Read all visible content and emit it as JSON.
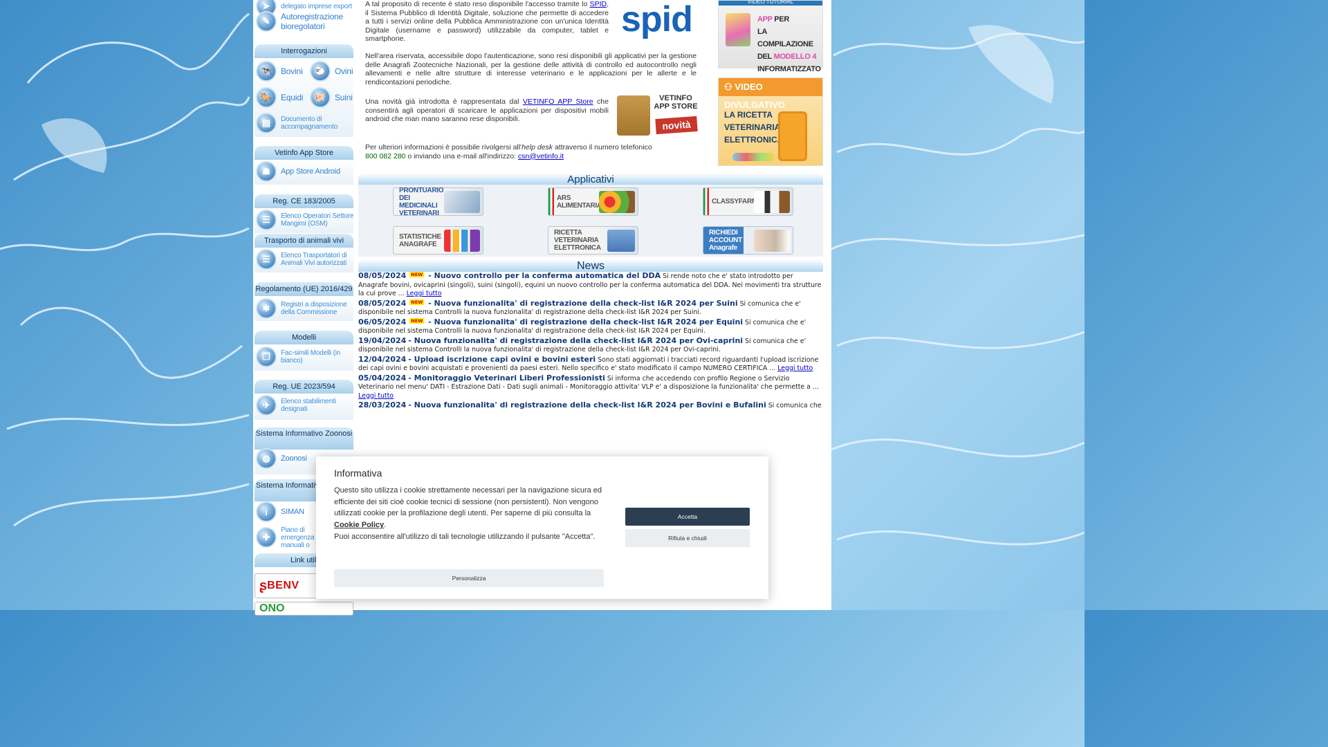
{
  "sidebar": {
    "top_item_partial": "delegato imprese export",
    "autoregistrazione": "Autoregistrazione bioregolatori",
    "sections": {
      "interrogazioni": "Interrogazioni",
      "app_store": "Vetinfo App Store",
      "reg_ce": "Reg. CE 183/2005",
      "trasporto": "Trasporto di animali vivi",
      "regolamento": "Regolamento (UE) 2016/429",
      "modelli": "Modelli",
      "reg_ue": "Reg. UE 2023/594",
      "zoonosi_title": "Sistema Informativo Zoonosi",
      "animali_title": "Sistema Informativo Animali",
      "link_utili": "Link utili"
    },
    "items": {
      "bovini": "Bovini",
      "ovini": "Ovini",
      "equidi": "Equidi",
      "suini": "Suini",
      "documento": "Documento di accompagnamento",
      "app_store_android": "App Store Android",
      "osm": "Elenco Operatori Settore Mangimi (OSM)",
      "trasportatori": "Elenco Trasportatori di Animali Vivi autorizzati",
      "registri": "Registri a disposizione della Commissione",
      "facsimili": "Fac-simili Modelli (in bianco)",
      "stabilimenti": "Elenco stabilimenti designati",
      "zoonosi": "Zoonosi",
      "siman": "SIMAN",
      "piano": "Piano di emergenza e manuali o",
      "benv": "BENV",
      "ono": "ONO"
    }
  },
  "intro": {
    "p1_a": "A tal proposito di recente è stato reso disponibile l'accesso tramite lo ",
    "p1_link": "SPID",
    "p1_b": ", il Sistema Pubblico di Identità Digitale, soluzione che permette di accedere a tutti i servizi online della Pubblica Amministrazione con un'unica Identità Digitale (username e password) utilizzabile da computer, tablet e smartphone.",
    "p2": "Nell'area riservata, accessibile dopo l'autenticazione, sono resi disponibili gli applicativi per la gestione delle Anagrafi Zootecniche Nazionali, per la gestione delle attività di controllo ed autocontrollo negli allevamenti e nelle altre strutture di interesse veterinario e le applicazioni per le allerte e le rendicontazioni periodiche.",
    "p3_a": "Una novità già introdotta è rappresentata dal ",
    "p3_link": "VETINFO APP Store",
    "p3_b": " che consentirà agli operatori di scaricare le applicazioni per dispositivi mobili android che man mano saranno rese disponibili.",
    "p4_a": "Per ulteriori informazioni è possibile rivolgersi all'",
    "p4_em": "help desk",
    "p4_b": " attraverso il numero telefonico",
    "phone": "800 082 280",
    "p4_c": " o inviando una e-mail all'indirizzo: ",
    "email": "csn@vetinfo.it",
    "spid_logo": "spid",
    "appstore_promo": "VETINFO APP STORE",
    "appstore_novita": "novità"
  },
  "promos": {
    "tutorial_header": "VIDEO TUTORIAL",
    "tutorial_l1a": "APP",
    "tutorial_l1b": " PER",
    "tutorial_l2": "LA COMPILAZIONE",
    "tutorial_l3a": "DEL ",
    "tutorial_l3b": "MODELLO 4",
    "tutorial_l4": "INFORMATIZZATO",
    "divulgativo_header": "VIDEO DIVULGATIVO",
    "divulgativo_l1": "LA RICETTA",
    "divulgativo_l2": "VETERINARIA",
    "divulgativo_l3": "ELETTRONICA"
  },
  "applicativi": {
    "title": "Applicativi",
    "apps": [
      "PRONTUARIO DEI MEDICINALI VETERINARI",
      "ARS ALIMENTARIA",
      "CLASSYFARM",
      "STATISTICHE ANAGRAFE",
      "RICETTA VETERINARIA ELETTRONICA",
      "RICHIEDI ACCOUNT Anagrafe"
    ]
  },
  "news": {
    "title": "News",
    "new_badge": "NEW",
    "read_more": "Leggi tutto",
    "items": [
      {
        "date": "08/05/2024",
        "isnew": true,
        "title": "Nuovo controllo per la conferma automatica del DDA",
        "text": "Si rende noto che e' stato introdotto per Anagrafe bovini, ovicaprini (singoli), suini (singoli), equini un nuovo controllo per la conferma automatica del DDA. Nei movimenti tra strutture la cui prove ...",
        "more": true
      },
      {
        "date": "08/05/2024",
        "isnew": true,
        "title": "Nuova funzionalita' di registrazione della check-list I&R 2024 per Suini",
        "text": "Si comunica che e' disponibile nel sistema Controlli la nuova funzionalita' di registrazione della check-list I&R 2024 per Suini.",
        "more": false
      },
      {
        "date": "06/05/2024",
        "isnew": true,
        "title": "Nuova funzionalita' di registrazione della check-list I&R 2024 per Equini",
        "text": "Si comunica che e' disponibile nel sistema Controlli la nuova funzionalita' di registrazione della check-list I&R 2024 per Equini.",
        "more": false
      },
      {
        "date": "19/04/2024",
        "isnew": false,
        "title": "Nuova funzionalita' di registrazione della check-list I&R 2024 per Ovi-caprini",
        "text": "Si comunica che e' disponibile nel sistema Controlli la nuova funzionalita' di registrazione della check-list I&R 2024 per Ovi-caprini.",
        "more": false
      },
      {
        "date": "12/04/2024",
        "isnew": false,
        "title": "Upload iscrizione capi ovini e bovini esteri",
        "text": "Sono stati aggiornati i tracciati record riguardanti l'upload iscrizione dei capi ovini e bovini acquistati e provenienti da paesi esteri. Nello specifico e' stato modificato il campo NUMERO CERTIFICA ...",
        "more": true
      },
      {
        "date": "05/04/2024",
        "isnew": false,
        "title": "Monitoraggio Veterinari Liberi Professionisti",
        "text": "Si informa che accedendo con profilo Regione o Servizio Veterinario nel menu' DATI - Estrazione Dati - Dati sugli animali - Monitoraggio attivita' VLP e' a disposizione la funzionalita' che permette a ...",
        "more": true
      },
      {
        "date": "28/03/2024",
        "isnew": false,
        "title": "Nuova funzionalita' di registrazione della check-list I&R 2024 per Bovini e Bufalini",
        "text": "Si comunica che",
        "more": false
      }
    ]
  },
  "cookie": {
    "title": "Informativa",
    "body_a": "Questo sito utilizza i cookie strettamente necessari per la navigazione sicura ed efficiente dei siti cioè cookie tecnici di sessione (non persistenti). Non vengono utilizzati cookie per la profilazione degli utenti. Per saperne di più consulta la ",
    "policy": "Cookie Policy",
    "body_b": ".",
    "body_c": "Puoi acconsentire all'utilizzo di tali tecnologie utilizzando il pulsante \"Accetta\".",
    "accept": "Accetta",
    "reject": "Rifiuta e chiudi",
    "customize": "Personalizza"
  }
}
